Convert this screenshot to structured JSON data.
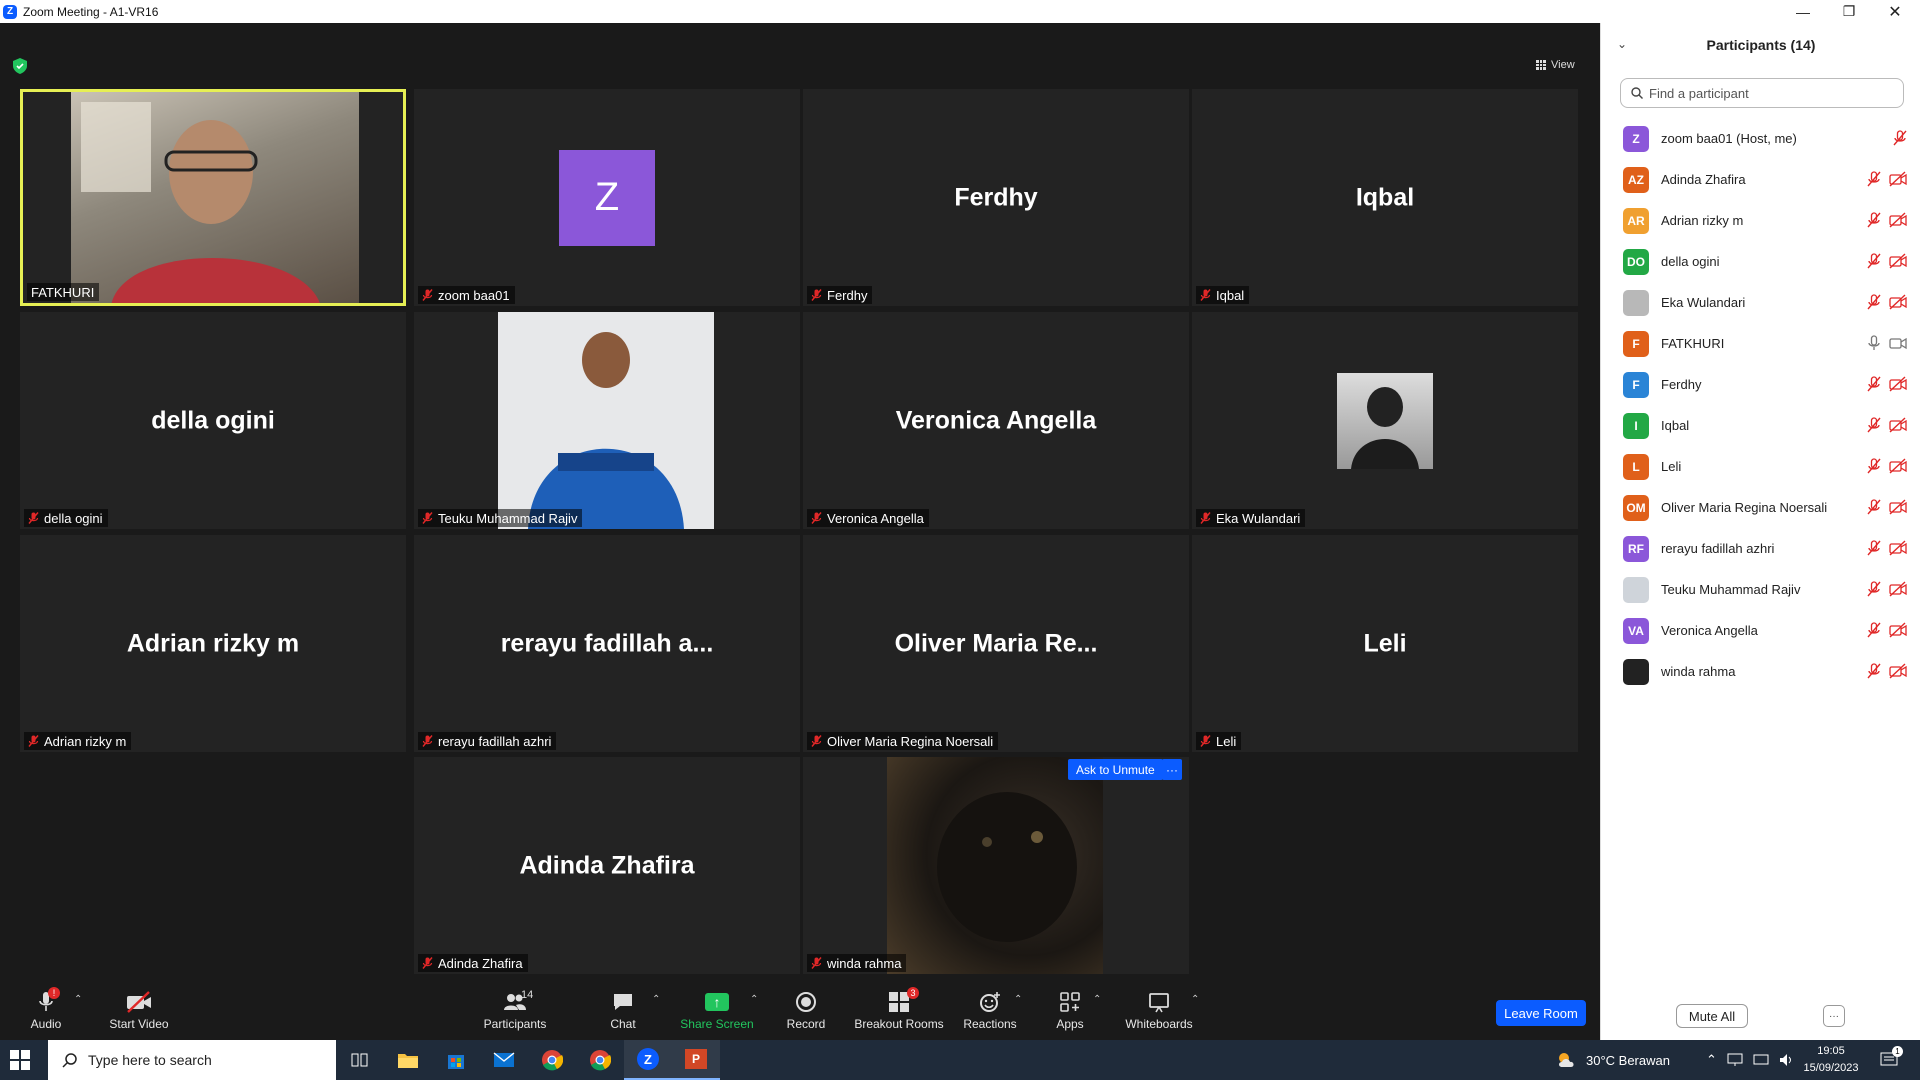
{
  "window": {
    "title": "Zoom Meeting - A1-VR16"
  },
  "meeting": {
    "view_label": "View",
    "tiles": [
      {
        "display": "",
        "label": "FATKHURI",
        "kind": "video-fatkhuri",
        "muted": false,
        "active": true
      },
      {
        "display": "Z",
        "label": "zoom baa01",
        "kind": "avatar-z",
        "muted": true
      },
      {
        "display": "Ferdhy",
        "label": "Ferdhy",
        "kind": "name",
        "muted": true
      },
      {
        "display": "Iqbal",
        "label": "Iqbal",
        "kind": "name",
        "muted": true
      },
      {
        "display": "della ogini",
        "label": "della ogini",
        "kind": "name",
        "muted": true
      },
      {
        "display": "",
        "label": "Teuku Muhammad Rajiv",
        "kind": "photo-teuku",
        "muted": true
      },
      {
        "display": "Veronica Angella",
        "label": "Veronica Angella",
        "kind": "name",
        "muted": true
      },
      {
        "display": "",
        "label": "Eka Wulandari",
        "kind": "photo-eka",
        "muted": true
      },
      {
        "display": "Adrian rizky m",
        "label": "Adrian rizky m",
        "kind": "name",
        "muted": true
      },
      {
        "display": "rerayu fadillah a...",
        "label": "rerayu fadillah azhri",
        "kind": "name",
        "muted": true
      },
      {
        "display": "Oliver Maria Re...",
        "label": "Oliver Maria Regina Noersali",
        "kind": "name",
        "muted": true
      },
      {
        "display": "Leli",
        "label": "Leli",
        "kind": "name",
        "muted": true
      },
      {
        "display": "Adinda Zhafira",
        "label": "Adinda Zhafira",
        "kind": "name",
        "muted": true
      },
      {
        "display": "",
        "label": "winda rahma",
        "kind": "video-winda",
        "muted": true
      }
    ],
    "ask_to_unmute": "Ask to Unmute",
    "tile_more": "···"
  },
  "toolbar": {
    "audio": {
      "label": "Audio",
      "badge": "!"
    },
    "start_video": {
      "label": "Start Video"
    },
    "participants": {
      "label": "Participants",
      "count": "14"
    },
    "chat": {
      "label": "Chat"
    },
    "share_screen": {
      "label": "Share Screen"
    },
    "record": {
      "label": "Record"
    },
    "breakout_rooms": {
      "label": "Breakout Rooms",
      "badge": "3"
    },
    "reactions": {
      "label": "Reactions"
    },
    "apps": {
      "label": "Apps"
    },
    "whiteboards": {
      "label": "Whiteboards"
    },
    "leave": {
      "label": "Leave Room"
    },
    "colors": {
      "share": "#22c55e",
      "leave": "#0b5cff",
      "badge": "#e02828"
    }
  },
  "panel": {
    "title": "Participants (14)",
    "search_placeholder": "Find a participant",
    "mute_all": "Mute All",
    "more": "···",
    "participants": [
      {
        "initials": "Z",
        "name": "zoom baa01 (Host, me)",
        "color": "#8b57d9",
        "mic": "muted",
        "video": "none"
      },
      {
        "initials": "AZ",
        "name": "Adinda Zhafira",
        "color": "#e0601a",
        "mic": "muted",
        "video": "off"
      },
      {
        "initials": "AR",
        "name": "Adrian rizky m",
        "color": "#f0a030",
        "mic": "muted",
        "video": "off"
      },
      {
        "initials": "DO",
        "name": "della ogini",
        "color": "#22a845",
        "mic": "muted",
        "video": "off"
      },
      {
        "initials": "",
        "name": "Eka Wulandari",
        "color": "#b8b8b8",
        "mic": "muted",
        "video": "off"
      },
      {
        "initials": "F",
        "name": "FATKHURI",
        "color": "#e0601a",
        "mic": "on",
        "video": "on"
      },
      {
        "initials": "F",
        "name": "Ferdhy",
        "color": "#2a84d6",
        "mic": "muted",
        "video": "off"
      },
      {
        "initials": "I",
        "name": "Iqbal",
        "color": "#22a845",
        "mic": "muted",
        "video": "off"
      },
      {
        "initials": "L",
        "name": "Leli",
        "color": "#e0601a",
        "mic": "muted",
        "video": "off"
      },
      {
        "initials": "OM",
        "name": "Oliver Maria Regina Noersali",
        "color": "#e0601a",
        "mic": "muted",
        "video": "off"
      },
      {
        "initials": "RF",
        "name": "rerayu fadillah azhri",
        "color": "#8b57d9",
        "mic": "muted",
        "video": "off"
      },
      {
        "initials": "",
        "name": "Teuku Muhammad Rajiv",
        "color": "#cfd4da",
        "mic": "muted",
        "video": "off"
      },
      {
        "initials": "VA",
        "name": "Veronica Angella",
        "color": "#8b57d9",
        "mic": "muted",
        "video": "off"
      },
      {
        "initials": "",
        "name": "winda rahma",
        "color": "#222222",
        "mic": "muted",
        "video": "off"
      }
    ]
  },
  "taskbar": {
    "search_placeholder": "Type here to search",
    "weather": "30°C Berawan",
    "time": "19:05",
    "date": "15/09/2023",
    "notification_badge": "1"
  }
}
